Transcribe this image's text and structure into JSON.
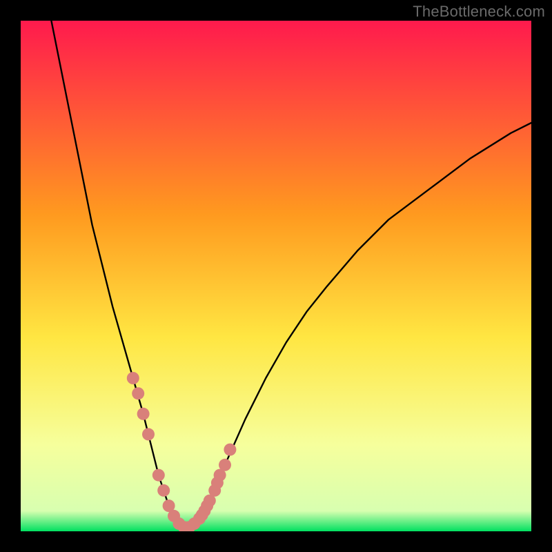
{
  "watermark": "TheBottleneck.com",
  "colors": {
    "frame": "#000000",
    "grad_top": "#ff1a4d",
    "grad_mid1": "#ff9a1f",
    "grad_mid2": "#ffe642",
    "grad_low": "#f6ff9c",
    "grad_bottom": "#00e060",
    "curve": "#000000",
    "marker": "#d9807a"
  },
  "chart_data": {
    "type": "line",
    "title": "",
    "xlabel": "",
    "ylabel": "",
    "xlim": [
      0,
      100
    ],
    "ylim": [
      0,
      100
    ],
    "series": [
      {
        "name": "bottleneck-curve",
        "x": [
          6,
          8,
          10,
          12,
          14,
          16,
          18,
          20,
          22,
          24,
          25,
          26,
          27,
          28,
          29,
          30,
          31,
          32,
          33,
          34,
          36,
          38,
          40,
          44,
          48,
          52,
          56,
          60,
          66,
          72,
          80,
          88,
          96,
          100
        ],
        "y": [
          100,
          90,
          80,
          70,
          60,
          52,
          44,
          37,
          30,
          23,
          19,
          15,
          11,
          8,
          5,
          3,
          1.5,
          0.8,
          0.8,
          1.5,
          4,
          8,
          13,
          22,
          30,
          37,
          43,
          48,
          55,
          61,
          67,
          73,
          78,
          80
        ]
      }
    ],
    "markers": {
      "name": "highlight-points",
      "x": [
        22,
        23,
        24,
        25,
        27,
        28,
        29,
        30,
        31,
        32,
        33,
        34,
        35,
        35.5,
        36,
        36.5,
        37,
        38,
        38.5,
        39,
        40,
        41
      ],
      "y": [
        30,
        27,
        23,
        19,
        11,
        8,
        5,
        3,
        1.5,
        0.8,
        0.8,
        1.5,
        2.5,
        3.2,
        4,
        5,
        6,
        8,
        9.5,
        11,
        13,
        16
      ]
    }
  }
}
